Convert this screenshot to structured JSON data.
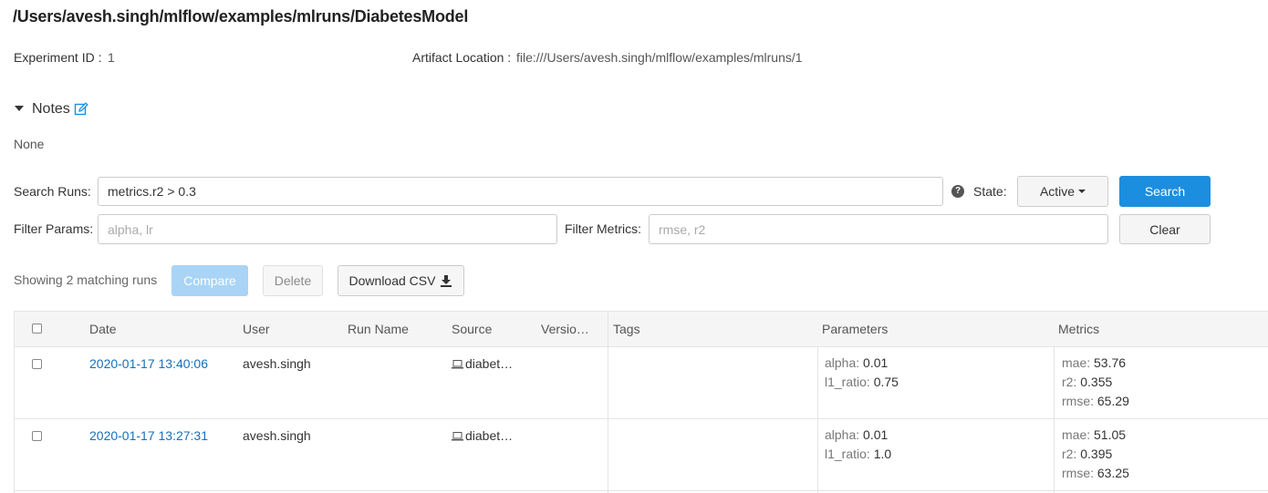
{
  "experiment": {
    "title": "/Users/avesh.singh/mlflow/examples/mlruns/DiabetesModel",
    "id_label": "Experiment ID :",
    "id_value": "1",
    "artifact_label": "Artifact Location :",
    "artifact_value": "file:///Users/avesh.singh/mlflow/examples/mlruns/1"
  },
  "notes": {
    "title": "Notes",
    "content": "None"
  },
  "search": {
    "search_runs_label": "Search Runs:",
    "search_runs_value": "metrics.r2 > 0.3",
    "state_label": "State:",
    "state_value": "Active",
    "search_button": "Search",
    "filter_params_label": "Filter Params:",
    "filter_params_placeholder": "alpha, lr",
    "filter_metrics_label": "Filter Metrics:",
    "filter_metrics_placeholder": "rmse, r2",
    "clear_button": "Clear",
    "help_glyph": "?"
  },
  "runs_toolbar": {
    "matching_text": "Showing 2 matching runs",
    "compare_button": "Compare",
    "delete_button": "Delete",
    "download_button": "Download CSV"
  },
  "table": {
    "headers": {
      "date": "Date",
      "user": "User",
      "run_name": "Run Name",
      "source": "Source",
      "version": "Versio…",
      "tags": "Tags",
      "parameters": "Parameters",
      "metrics": "Metrics"
    },
    "rows": [
      {
        "date": "2020-01-17 13:40:06",
        "user": "avesh.singh",
        "run_name": "",
        "source": "diabet…",
        "version": "",
        "params": [
          {
            "key": "alpha:",
            "value": "0.01"
          },
          {
            "key": "l1_ratio:",
            "value": "0.75"
          }
        ],
        "metrics": [
          {
            "key": "mae:",
            "value": "53.76"
          },
          {
            "key": "r2:",
            "value": "0.355"
          },
          {
            "key": "rmse:",
            "value": "65.29"
          }
        ]
      },
      {
        "date": "2020-01-17 13:27:31",
        "user": "avesh.singh",
        "run_name": "",
        "source": "diabet…",
        "version": "",
        "params": [
          {
            "key": "alpha:",
            "value": "0.01"
          },
          {
            "key": "l1_ratio:",
            "value": "1.0"
          }
        ],
        "metrics": [
          {
            "key": "mae:",
            "value": "51.05"
          },
          {
            "key": "r2:",
            "value": "0.395"
          },
          {
            "key": "rmse:",
            "value": "63.25"
          }
        ]
      }
    ]
  },
  "colors": {
    "primary": "#1c8ee0",
    "link": "#1a6fb8",
    "disabled_primary": "#a9d4f5"
  },
  "icons": {
    "edit": "edit-icon",
    "help": "help-icon",
    "download": "download-icon",
    "source": "laptop-icon",
    "notes_toggle": "caret-down-icon"
  }
}
